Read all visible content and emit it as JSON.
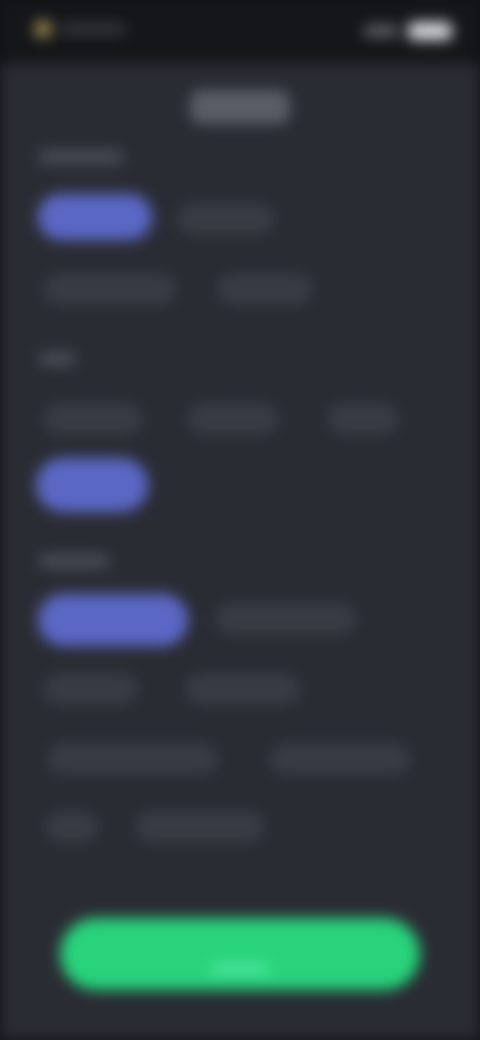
{
  "status_bar": {
    "signal_icon": "signal-icon",
    "battery_icon": "battery-icon"
  },
  "screen": {
    "title": "",
    "note": ""
  },
  "colors": {
    "background": "#2a2c34",
    "status_bar": "#15161a",
    "chip": "#3b3d46",
    "chip_selected": "#5a67c4",
    "primary_button": "#28d37b"
  },
  "sections": [
    {
      "label": "",
      "options": [
        {
          "label": "",
          "selected": true
        },
        {
          "label": "",
          "selected": false
        },
        {
          "label": "",
          "selected": false
        },
        {
          "label": "",
          "selected": false
        }
      ]
    },
    {
      "label": "",
      "options": [
        {
          "label": "",
          "selected": false
        },
        {
          "label": "",
          "selected": false
        },
        {
          "label": "",
          "selected": false
        },
        {
          "label": "",
          "selected": true
        }
      ]
    },
    {
      "label": "",
      "options": [
        {
          "label": "",
          "selected": true
        },
        {
          "label": "",
          "selected": false
        },
        {
          "label": "",
          "selected": false
        },
        {
          "label": "",
          "selected": false
        },
        {
          "label": "",
          "selected": false
        },
        {
          "label": "",
          "selected": false
        },
        {
          "label": "",
          "selected": false
        },
        {
          "label": "",
          "selected": false
        }
      ]
    }
  ],
  "primary_button": {
    "label": ""
  }
}
